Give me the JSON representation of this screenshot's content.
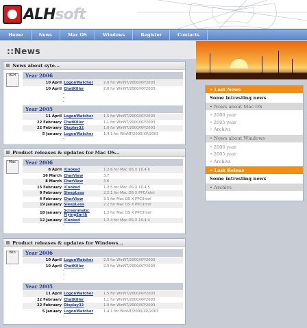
{
  "brand": {
    "logo_main": "ALH",
    "logo_soft": "soft"
  },
  "nav": [
    "Home",
    "News",
    "Mac OS",
    "Windows",
    "Register",
    "Contacts"
  ],
  "page_title": "::News",
  "panels": [
    {
      "title": "News about syte...",
      "icon": "alh-logo-icon",
      "icon_label": "ALH",
      "years": [
        {
          "year": "Year 2006",
          "rows": [
            {
              "date": "10 April",
              "name": "LogonWatcher",
              "info": "2.0 for WinNT/2000/XP/2003"
            },
            {
              "date": "10 April",
              "name": "ChatKiller",
              "info": "2.0 for WinNT/2000/XP/2003"
            }
          ],
          "dots": [
            "-",
            "-",
            "-"
          ]
        },
        {
          "year": "Year 2005",
          "rows": [
            {
              "date": "11 April",
              "name": "LogonWatcher",
              "info": "1.5 for WinNT/2000/XP/2003"
            },
            {
              "date": "22 February",
              "name": "ChatKiller",
              "info": "1.1 for WinNT/2000/XP/2003"
            },
            {
              "date": "22 February",
              "name": "Display32",
              "info": "1.0 for WinNT/2000/XP/2003"
            },
            {
              "date": "5 January",
              "name": "LogonWatcher",
              "info": "1.4.1 for WinNT/2000/XP/2003"
            }
          ],
          "dots": [
            "-"
          ]
        }
      ]
    },
    {
      "title": "Product releases & updates for Mac OS...",
      "icon": "mac-icon",
      "icon_label": "Mac",
      "years": [
        {
          "year": "Year 2006",
          "rows": [
            {
              "date": "8 April",
              "name": "iCooked",
              "info": "1.2.6 for Mac OS X 10.4.6"
            },
            {
              "date": "16 March",
              "name": "CharView",
              "info": "3.7"
            },
            {
              "date": "8 March",
              "name": "CharView",
              "info": "3.6"
            },
            {
              "date": "15 February",
              "name": "iCooked",
              "info": "1.2.5 for Mac OS X 10.4.5"
            },
            {
              "date": "9 February",
              "name": "SleepLess",
              "info": "2.2.1 for Mac OS X PPC/Intel"
            },
            {
              "date": "4 February",
              "name": "CharView",
              "info": "3.5 for Mac OS X PPC/Intel"
            },
            {
              "date": "19 January",
              "name": "SleepLess",
              "info": "2.2 for Mac OS X PPC/Intel"
            },
            {
              "date": "18 January",
              "name": "Screenmate: FlyingEarth",
              "info": "1.2 for Mac OS X PPC/Intel"
            },
            {
              "date": "12 January",
              "name": "iCooked",
              "info": "1.2.4 for Mac OS X 10.4.4"
            }
          ],
          "dots": [
            "-"
          ]
        }
      ]
    },
    {
      "title": "Product releases & updates for Windows...",
      "icon": "windows-icon",
      "icon_label": "Win",
      "years": [
        {
          "year": "Year 2006",
          "rows": [
            {
              "date": "10 April",
              "name": "LogonWatcher",
              "info": "2.0 for WinNT/2000/XP/2003"
            },
            {
              "date": "10 April",
              "name": "ChatKiller",
              "info": "2.0 for WinNT/2000/XP/2003"
            }
          ],
          "dots": [
            "-",
            "-",
            "-"
          ]
        },
        {
          "year": "Year 2005",
          "rows": [
            {
              "date": "11 April",
              "name": "LogonWatcher",
              "info": "1.5 for WinNT/2000/XP/2003"
            },
            {
              "date": "22 February",
              "name": "ChatKiller",
              "info": "1.1 for WinNT/2000/XP/2003"
            },
            {
              "date": "22 February",
              "name": "Display32",
              "info": "1.0 for WinNT/2000/XP/2003"
            },
            {
              "date": "5 January",
              "name": "LogonWatcher",
              "info": "1.4.1 for WinNT/2000/XP/2003"
            }
          ],
          "dots": [
            "-"
          ]
        }
      ]
    }
  ],
  "sidebar": {
    "last_news": "Last News",
    "news_item": "Some intresting news",
    "mac_head": "News about Mac OS",
    "mac_links": [
      "2006 year",
      "2005 year",
      "Archivs"
    ],
    "win_head": "News about Windows",
    "win_links": [
      "2006 year",
      "2005 year",
      "Archivs"
    ],
    "last_releas": "Last Releas",
    "releas_item": "Some intresting news",
    "archivs": "Archivs"
  },
  "colors": {
    "accent": "#f48d12",
    "nav": "#5b86c8",
    "link": "#1f3f9a",
    "bg": "#c8ccd4"
  }
}
